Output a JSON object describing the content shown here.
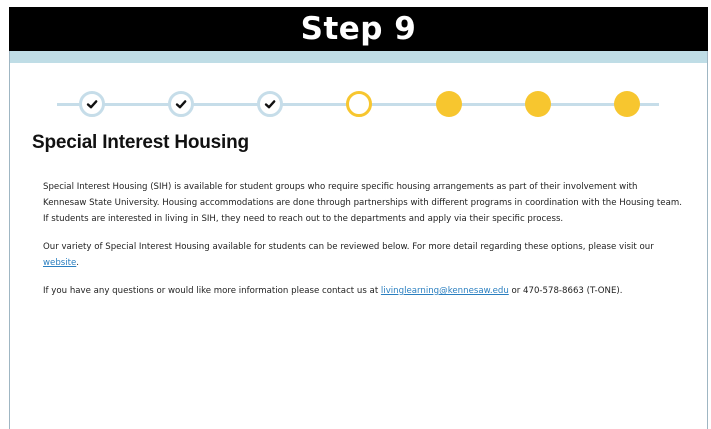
{
  "banner": {
    "title": "Step 9"
  },
  "progress": {
    "steps": [
      {
        "state": "done"
      },
      {
        "state": "done"
      },
      {
        "state": "done"
      },
      {
        "state": "current"
      },
      {
        "state": "todo"
      },
      {
        "state": "todo"
      },
      {
        "state": "todo"
      }
    ],
    "colors": {
      "track": "#c6dde9",
      "accent": "#f7c62f"
    }
  },
  "section": {
    "heading": "Special Interest Housing",
    "para1": "Special Interest Housing (SIH) is available for student groups who require specific housing arrangements as part of their involvement with Kennesaw State University. Housing accommodations are done through partnerships with different programs in coordination with the Housing team. If students are interested in living in SIH, they need to reach out to the departments and apply via their specific process.",
    "para2_before": "Our variety of Special Interest Housing available for students can be reviewed below. For more detail regarding these options, please visit our ",
    "para2_link": "website",
    "para2_after": ".",
    "para3_before": "If you have any questions or would like more information please contact us at ",
    "para3_link": "livinglearning@kennesaw.edu",
    "para3_after": " or 470-578-8663 (T-ONE)."
  }
}
